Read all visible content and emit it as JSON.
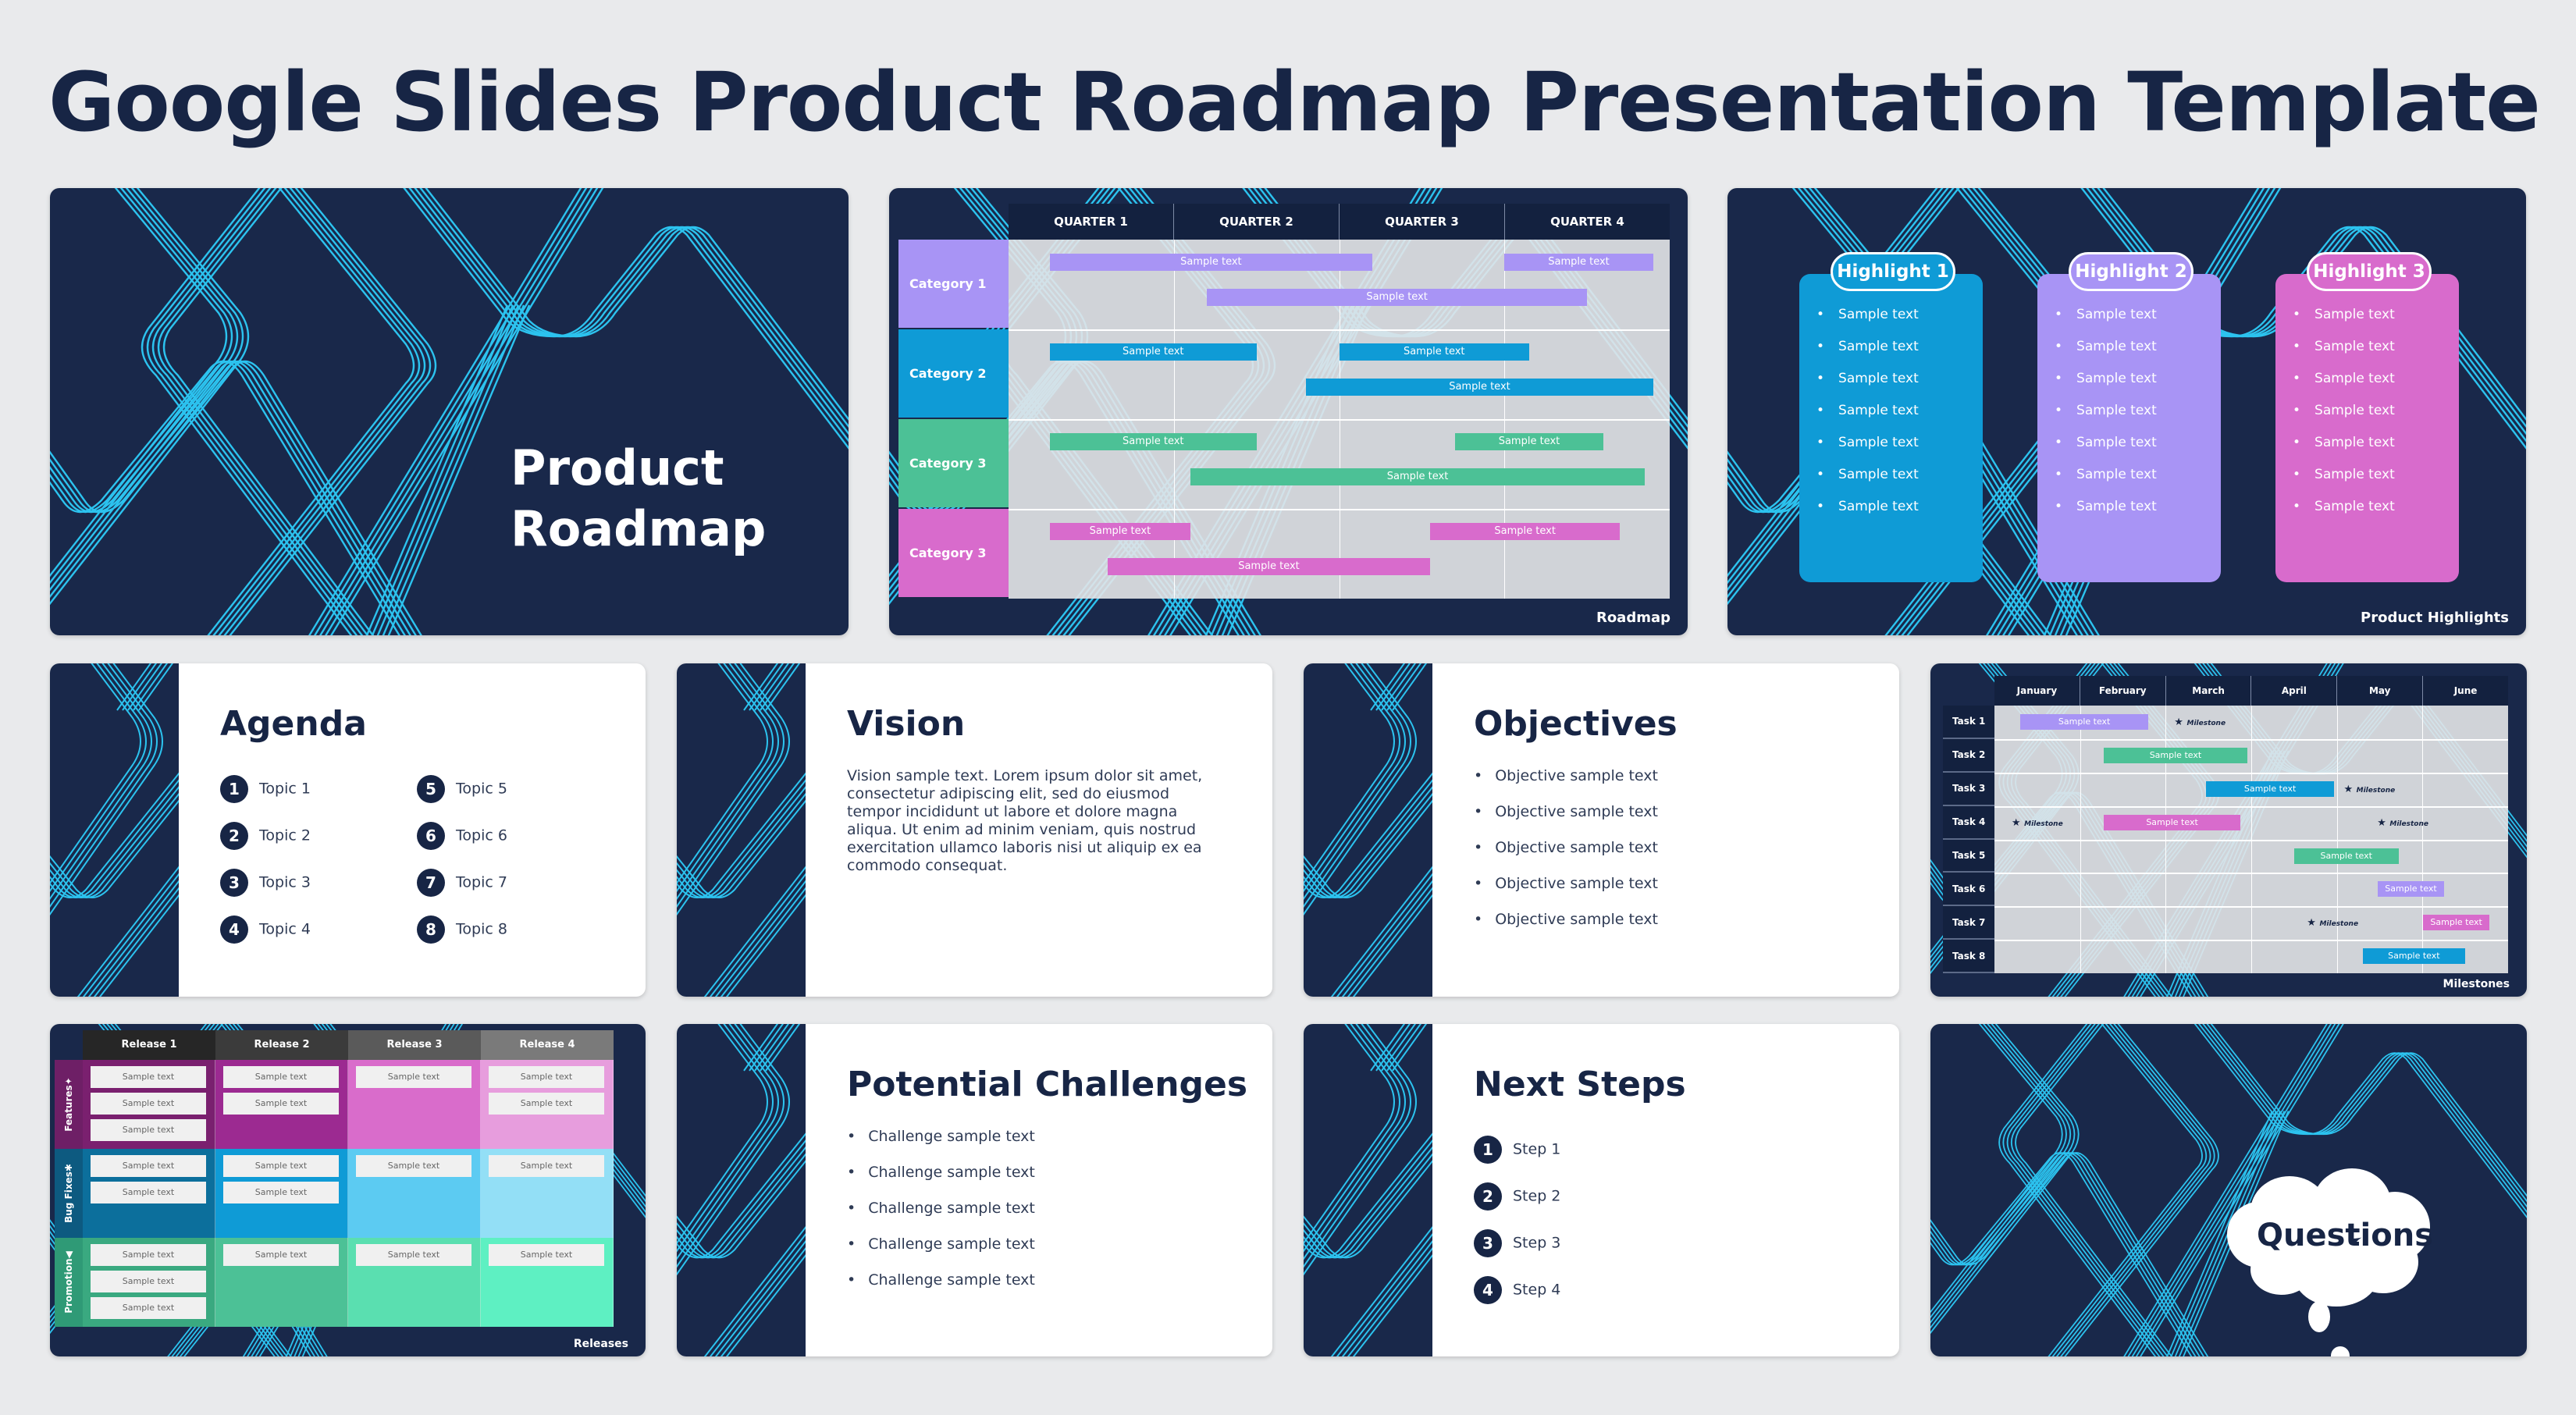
{
  "page": {
    "title": "Google Slides Product Roadmap Presentation Template"
  },
  "colors": {
    "navy": "#19284a",
    "cyan": "#2cc3ef",
    "purple": "#a894f5",
    "blue": "#0f9bd6",
    "green": "#4cc196",
    "pink": "#d86bcc",
    "background": "#e9eaec"
  },
  "slides": {
    "cover": {
      "title_line1": "Product",
      "title_line2": "Roadmap"
    },
    "roadmap": {
      "footer": "Roadmap",
      "quarters": [
        "QUARTER 1",
        "QUARTER 2",
        "QUARTER 3",
        "QUARTER 4"
      ],
      "categories": [
        {
          "label": "Category 1",
          "color": "#a894f5",
          "bars": [
            {
              "text": "Sample text",
              "start": 0.25,
              "end": 2.2,
              "lane": 0
            },
            {
              "text": "Sample text",
              "start": 3.0,
              "end": 3.9,
              "lane": 0
            },
            {
              "text": "Sample text",
              "start": 1.2,
              "end": 3.5,
              "lane": 1
            }
          ]
        },
        {
          "label": "Category 2",
          "color": "#0f9bd6",
          "bars": [
            {
              "text": "Sample text",
              "start": 0.25,
              "end": 1.5,
              "lane": 0
            },
            {
              "text": "Sample text",
              "start": 2.0,
              "end": 3.15,
              "lane": 0
            },
            {
              "text": "Sample text",
              "start": 1.8,
              "end": 3.9,
              "lane": 1
            }
          ]
        },
        {
          "label": "Category 3",
          "color": "#4cc196",
          "bars": [
            {
              "text": "Sample text",
              "start": 0.25,
              "end": 1.5,
              "lane": 0
            },
            {
              "text": "Sample text",
              "start": 2.7,
              "end": 3.6,
              "lane": 0
            },
            {
              "text": "Sample text",
              "start": 1.1,
              "end": 3.85,
              "lane": 1
            }
          ]
        },
        {
          "label": "Category 3",
          "color": "#d86bcc",
          "bars": [
            {
              "text": "Sample text",
              "start": 0.25,
              "end": 1.1,
              "lane": 0
            },
            {
              "text": "Sample text",
              "start": 2.55,
              "end": 3.7,
              "lane": 0
            },
            {
              "text": "Sample text",
              "start": 0.6,
              "end": 2.55,
              "lane": 1
            }
          ]
        }
      ]
    },
    "highlights": {
      "footer": "Product Highlights",
      "cards": [
        {
          "title": "Highlight 1",
          "color": "#0f9bd6",
          "items": [
            "Sample text",
            "Sample text",
            "Sample text",
            "Sample text",
            "Sample text",
            "Sample text",
            "Sample text"
          ]
        },
        {
          "title": "Highlight 2",
          "color": "#a894f5",
          "items": [
            "Sample text",
            "Sample text",
            "Sample text",
            "Sample text",
            "Sample text",
            "Sample text",
            "Sample text"
          ]
        },
        {
          "title": "Highlight 3",
          "color": "#d86bcc",
          "items": [
            "Sample text",
            "Sample text",
            "Sample text",
            "Sample text",
            "Sample text",
            "Sample text",
            "Sample text"
          ]
        }
      ]
    },
    "agenda": {
      "title": "Agenda",
      "topics": [
        "Topic 1",
        "Topic 2",
        "Topic 3",
        "Topic 4",
        "Topic 5",
        "Topic 6",
        "Topic 7",
        "Topic 8"
      ]
    },
    "vision": {
      "title": "Vision",
      "body": "Vision sample text. Lorem ipsum dolor sit amet, consectetur adipiscing elit, sed do eiusmod tempor incididunt ut labore et dolore magna aliqua. Ut enim ad minim veniam, quis nostrud exercitation ullamco laboris nisi ut aliquip ex ea commodo consequat."
    },
    "objectives": {
      "title": "Objectives",
      "items": [
        "Objective sample text",
        "Objective sample text",
        "Objective sample text",
        "Objective sample text",
        "Objective sample text"
      ]
    },
    "milestones": {
      "footer": "Milestones",
      "months": [
        "January",
        "February",
        "March",
        "April",
        "May",
        "June"
      ],
      "tasks": [
        "Task 1",
        "Task 2",
        "Task 3",
        "Task 4",
        "Task 5",
        "Task 6",
        "Task 7",
        "Task 8"
      ],
      "bars": [
        {
          "task": 0,
          "start": 0.3,
          "end": 1.8,
          "text": "Sample text",
          "color": "#a894f5"
        },
        {
          "task": 1,
          "start": 1.28,
          "end": 2.95,
          "text": "Sample text",
          "color": "#4cc196"
        },
        {
          "task": 2,
          "start": 2.47,
          "end": 3.97,
          "text": "Sample text",
          "color": "#0f9bd6"
        },
        {
          "task": 3,
          "start": 1.28,
          "end": 2.87,
          "text": "Sample text",
          "color": "#d86bcc"
        },
        {
          "task": 4,
          "start": 3.5,
          "end": 4.72,
          "text": "Sample text",
          "color": "#4cc196"
        },
        {
          "task": 5,
          "start": 4.48,
          "end": 5.25,
          "text": "Sample text",
          "color": "#a894f5"
        },
        {
          "task": 6,
          "start": 5.01,
          "end": 5.78,
          "text": "Sample text",
          "color": "#d86bcc"
        },
        {
          "task": 7,
          "start": 4.3,
          "end": 5.5,
          "text": "Sample text",
          "color": "#0f9bd6"
        }
      ],
      "milestones": [
        {
          "task": 0,
          "at": 2.1,
          "label": "Milestone"
        },
        {
          "task": 2,
          "at": 4.08,
          "label": "Milestone"
        },
        {
          "task": 3,
          "at": 0.2,
          "label": "Milestone"
        },
        {
          "task": 3,
          "at": 4.47,
          "label": "Milestone"
        },
        {
          "task": 6,
          "at": 3.65,
          "label": "Milestone"
        }
      ]
    },
    "releases": {
      "footer": "Releases",
      "headers": [
        "Release 1",
        "Release 2",
        "Release 3",
        "Release 4"
      ],
      "header_colors": [
        "#262626",
        "#3b3b3b",
        "#5a5a5a",
        "#7a7a7a"
      ],
      "rows": [
        {
          "label": "Features",
          "icon": "sparkle-stars-icon",
          "label_color": "#6e1f66",
          "cell_colors": [
            "#7a206f",
            "#9c2a91",
            "#d96ccb",
            "#e79ddd"
          ],
          "counts": [
            3,
            2,
            1,
            2
          ]
        },
        {
          "label": "Bug Fixes",
          "icon": "bug-icon",
          "label_color": "#0d5a80",
          "cell_colors": [
            "#0c6f9c",
            "#0f9bd6",
            "#5ccbf2",
            "#93dff6"
          ],
          "counts": [
            2,
            2,
            1,
            1
          ]
        },
        {
          "label": "Promotion",
          "icon": "megaphone-icon",
          "label_color": "#2f9a76",
          "cell_colors": [
            "#3aa980",
            "#4cc196",
            "#5adfb0",
            "#5ef0c2"
          ],
          "counts": [
            3,
            1,
            1,
            1
          ]
        }
      ],
      "box_text": "Sample text"
    },
    "challenges": {
      "title": "Potential Challenges",
      "items": [
        "Challenge sample text",
        "Challenge sample text",
        "Challenge sample text",
        "Challenge sample text",
        "Challenge sample text"
      ]
    },
    "next_steps": {
      "title": "Next Steps",
      "steps": [
        "Step 1",
        "Step 2",
        "Step 3",
        "Step 4"
      ]
    },
    "questions": {
      "title": "Questions"
    }
  }
}
